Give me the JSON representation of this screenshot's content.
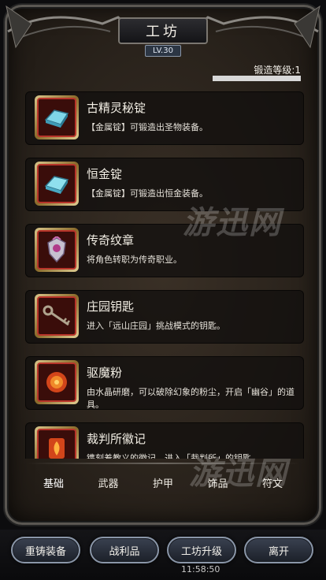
{
  "header": {
    "title": "工坊",
    "level": "LV.30",
    "forge_level_label": "锻造等级:1",
    "forge_progress": 1.0
  },
  "items": [
    {
      "name": "古精灵秘锭",
      "desc": "【金属锭】可锻造出圣物装备。",
      "icon": "blue-ingot-icon",
      "frame": "red"
    },
    {
      "name": "恒金锭",
      "desc": "【金属锭】可锻造出恒金装备。",
      "icon": "blue-ingot-icon",
      "frame": "red"
    },
    {
      "name": "传奇纹章",
      "desc": "将角色转职为传奇职业。",
      "icon": "emblem-icon",
      "frame": "red"
    },
    {
      "name": "庄园钥匙",
      "desc": "进入「远山庄园」挑战模式的钥匙。",
      "icon": "key-icon",
      "frame": "red"
    },
    {
      "name": "驱魔粉",
      "desc": "由水晶研磨，可以破除幻象的粉尘，开启「幽谷」的道具。",
      "icon": "fire-powder-icon",
      "frame": "red"
    },
    {
      "name": "裁判所徽记",
      "desc": "镌刻着教义的徽记，进入「裁判所」的钥匙。",
      "icon": "fire-seal-icon",
      "frame": "red"
    }
  ],
  "tabs": [
    "基础",
    "武器",
    "护甲",
    "饰品",
    "符文"
  ],
  "bottom_buttons": [
    "重铸装备",
    "战利品",
    "工坊升级",
    "离开"
  ],
  "clock": "11:58:50",
  "watermark": "游迅网"
}
